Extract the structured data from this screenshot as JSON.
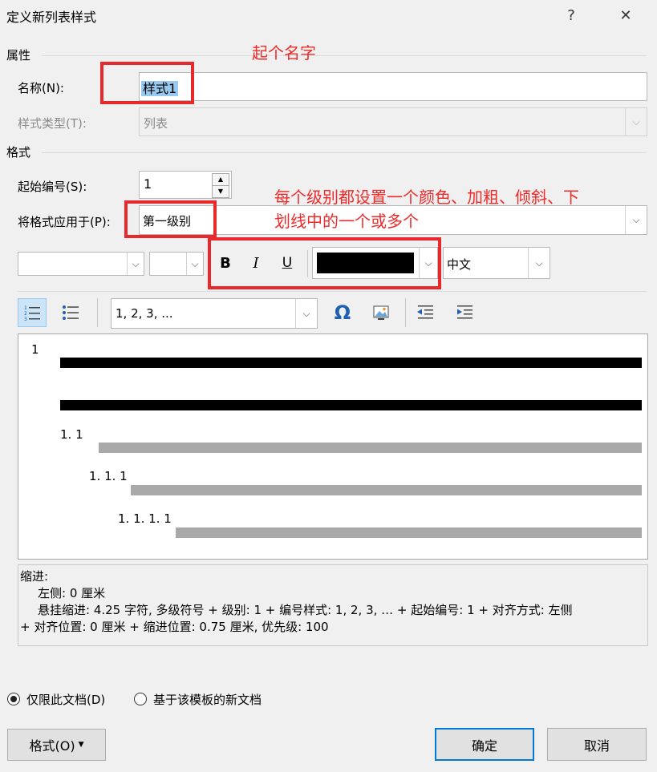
{
  "window": {
    "title": "定义新列表样式",
    "help": "?",
    "close": "✕"
  },
  "properties": {
    "section": "属性",
    "name_label": "名称(N):",
    "name_value": "样式1",
    "type_label": "样式类型(T):",
    "type_value": "列表"
  },
  "format": {
    "section": "格式",
    "start_label": "起始编号(S):",
    "start_value": "1",
    "apply_label": "将格式应用于(P):",
    "apply_value": "第一级别",
    "bold": "B",
    "italic": "I",
    "underline": "U",
    "language_value": "中文",
    "number_style": "1, 2, 3, ...",
    "symbol_glyph": "Ω",
    "font_color": "#000000"
  },
  "annotations": {
    "name_hint": "起个名字",
    "level_hint_line1": "每个级别都设置一个颜色、加粗、倾斜、下",
    "level_hint_line2": "划线中的一个或多个",
    "color": "#e8292b"
  },
  "preview": {
    "level1": "1",
    "level2": "1. 1",
    "level3": "1. 1. 1",
    "level4": "1. 1. 1. 1"
  },
  "description": {
    "heading": "缩进:",
    "line1": "左侧:  0 厘米",
    "line2": "悬挂缩进: 4.25 字符, 多级符号 + 级别: 1 + 编号样式: 1, 2, 3, … + 起始编号: 1 + 对齐方式: 左侧",
    "line3": "+ 对齐位置:  0 厘米 + 缩进位置:  0.75 厘米, 优先级: 100"
  },
  "scope": {
    "this_doc": "仅限此文档(D)",
    "template": "基于该模板的新文档"
  },
  "buttons": {
    "format": "格式(O)",
    "ok": "确定",
    "cancel": "取消"
  }
}
